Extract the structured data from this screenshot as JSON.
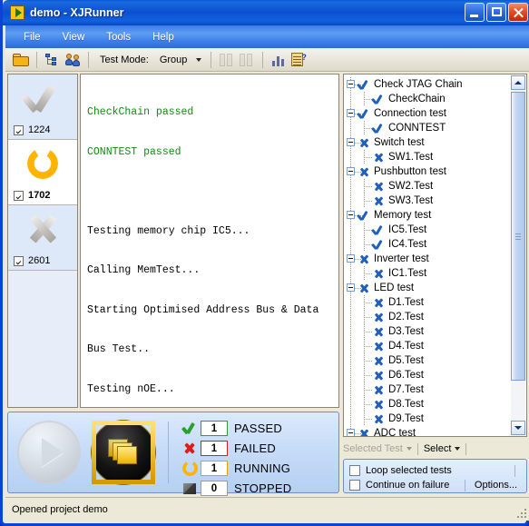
{
  "window": {
    "title_main": "demo",
    "title_sep": " - ",
    "title_app": "XJRunner",
    "app_icon": "play-triangle-icon",
    "minimize_label": "Minimize",
    "maximize_label": "Maximize",
    "close_label": "Close"
  },
  "menu": {
    "items": [
      {
        "label": "File"
      },
      {
        "label": "View"
      },
      {
        "label": "Tools"
      },
      {
        "label": "Help"
      }
    ]
  },
  "toolbar": {
    "open_icon": "open-folder-icon",
    "tree_icon": "hierarchy-tree-icon",
    "people_icon": "users-icon",
    "test_mode_label": "Test Mode:",
    "test_mode_value": "Group",
    "disabled_icon_1": "step-into-icon",
    "disabled_icon_2": "step-over-icon",
    "chart_icon": "bar-chart-icon",
    "report_icon": "report-notes-icon"
  },
  "thumbnails": {
    "items": [
      {
        "id": "1224",
        "state": "passed",
        "icon": "grey-check-icon",
        "checked": true,
        "selected": false
      },
      {
        "id": "1702",
        "state": "running",
        "icon": "orange-spinner-icon",
        "checked": true,
        "selected": true
      },
      {
        "id": "2601",
        "state": "failed",
        "icon": "grey-x-icon",
        "checked": true,
        "selected": false
      }
    ]
  },
  "console": {
    "lines": [
      {
        "text": "CheckChain passed",
        "style": "ok"
      },
      {
        "text": "CONNTEST passed",
        "style": "ok"
      },
      {
        "text": "",
        "style": "plain"
      },
      {
        "text": "Testing memory chip IC5...",
        "style": "plain"
      },
      {
        "text": "Calling MemTest...",
        "style": "plain"
      },
      {
        "text": "Starting Optimised Address Bus & Data",
        "style": "plain"
      },
      {
        "text": "Bus Test..",
        "style": "plain"
      },
      {
        "text": "Testing nOE...",
        "style": "plain"
      }
    ]
  },
  "controls": {
    "run_button": "run-play-button",
    "stop_button": "abort-stack-button",
    "status": [
      {
        "name": "PASSED",
        "count": "1",
        "icon": "green-check-icon",
        "color": "#2e9e2e"
      },
      {
        "name": "FAILED",
        "count": "1",
        "icon": "red-x-icon",
        "color": "#d42020"
      },
      {
        "name": "RUNNING",
        "count": "1",
        "icon": "orange-spinner-icon",
        "color": "#e8a000"
      },
      {
        "name": "STOPPED",
        "count": "0",
        "icon": "grey-square-icon",
        "color": "#9a9a9a"
      }
    ]
  },
  "tree": {
    "nodes": [
      {
        "label": "Check JTAG Chain",
        "status": "pass",
        "level": 0,
        "expander": true
      },
      {
        "label": "CheckChain",
        "status": "pass",
        "level": 1,
        "expander": false
      },
      {
        "label": "Connection test",
        "status": "pass",
        "level": 0,
        "expander": true
      },
      {
        "label": "CONNTEST",
        "status": "pass",
        "level": 1,
        "expander": false
      },
      {
        "label": "Switch test",
        "status": "fail",
        "level": 0,
        "expander": true
      },
      {
        "label": "SW1.Test",
        "status": "fail",
        "level": 1,
        "expander": false
      },
      {
        "label": "Pushbutton test",
        "status": "fail",
        "level": 0,
        "expander": true
      },
      {
        "label": "SW2.Test",
        "status": "fail",
        "level": 1,
        "expander": false
      },
      {
        "label": "SW3.Test",
        "status": "fail",
        "level": 1,
        "expander": false
      },
      {
        "label": "Memory test",
        "status": "pass",
        "level": 0,
        "expander": true
      },
      {
        "label": "IC5.Test",
        "status": "pass",
        "level": 1,
        "expander": false
      },
      {
        "label": "IC4.Test",
        "status": "pass",
        "level": 1,
        "expander": false
      },
      {
        "label": "Inverter test",
        "status": "fail",
        "level": 0,
        "expander": true
      },
      {
        "label": "IC1.Test",
        "status": "fail",
        "level": 1,
        "expander": false
      },
      {
        "label": "LED test",
        "status": "fail",
        "level": 0,
        "expander": true
      },
      {
        "label": "D1.Test",
        "status": "fail",
        "level": 1,
        "expander": false
      },
      {
        "label": "D2.Test",
        "status": "fail",
        "level": 1,
        "expander": false
      },
      {
        "label": "D3.Test",
        "status": "fail",
        "level": 1,
        "expander": false
      },
      {
        "label": "D4.Test",
        "status": "fail",
        "level": 1,
        "expander": false
      },
      {
        "label": "D5.Test",
        "status": "fail",
        "level": 1,
        "expander": false
      },
      {
        "label": "D6.Test",
        "status": "fail",
        "level": 1,
        "expander": false
      },
      {
        "label": "D7.Test",
        "status": "fail",
        "level": 1,
        "expander": false
      },
      {
        "label": "D8.Test",
        "status": "fail",
        "level": 1,
        "expander": false
      },
      {
        "label": "D9.Test",
        "status": "fail",
        "level": 1,
        "expander": false
      },
      {
        "label": "ADC test",
        "status": "fail",
        "level": 0,
        "expander": true
      }
    ],
    "scroll_up_icon": "scroll-up-arrow-icon",
    "scroll_down_icon": "scroll-down-arrow-icon"
  },
  "selection_bar": {
    "selected_test_label": "Selected Test",
    "selected_test_enabled": false,
    "select_label": "Select",
    "select_enabled": true
  },
  "options": {
    "loop_label": "Loop selected tests",
    "loop_checked": false,
    "continue_label": "Continue on failure",
    "continue_checked": false,
    "options_button": "Options..."
  },
  "statusbar": {
    "message": "Opened project demo"
  }
}
